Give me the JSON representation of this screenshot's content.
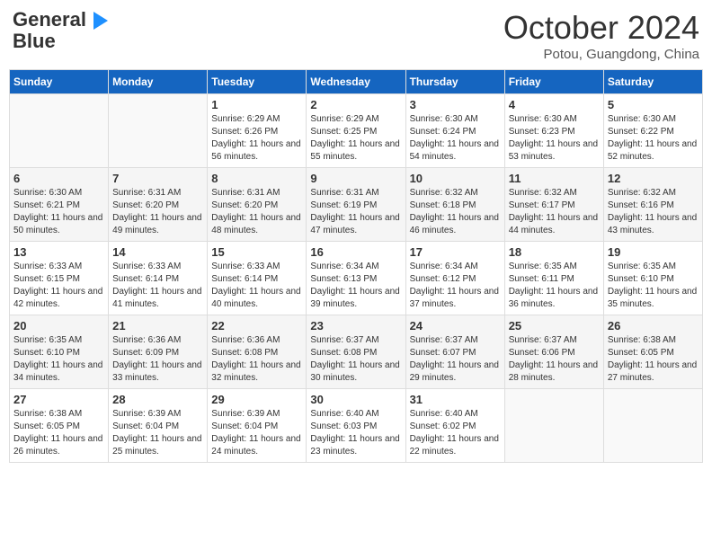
{
  "header": {
    "logo_line1": "General",
    "logo_line2": "Blue",
    "month": "October 2024",
    "location": "Potou, Guangdong, China"
  },
  "weekdays": [
    "Sunday",
    "Monday",
    "Tuesday",
    "Wednesday",
    "Thursday",
    "Friday",
    "Saturday"
  ],
  "weeks": [
    [
      {
        "day": "",
        "sunrise": "",
        "sunset": "",
        "daylight": ""
      },
      {
        "day": "",
        "sunrise": "",
        "sunset": "",
        "daylight": ""
      },
      {
        "day": "1",
        "sunrise": "Sunrise: 6:29 AM",
        "sunset": "Sunset: 6:26 PM",
        "daylight": "Daylight: 11 hours and 56 minutes."
      },
      {
        "day": "2",
        "sunrise": "Sunrise: 6:29 AM",
        "sunset": "Sunset: 6:25 PM",
        "daylight": "Daylight: 11 hours and 55 minutes."
      },
      {
        "day": "3",
        "sunrise": "Sunrise: 6:30 AM",
        "sunset": "Sunset: 6:24 PM",
        "daylight": "Daylight: 11 hours and 54 minutes."
      },
      {
        "day": "4",
        "sunrise": "Sunrise: 6:30 AM",
        "sunset": "Sunset: 6:23 PM",
        "daylight": "Daylight: 11 hours and 53 minutes."
      },
      {
        "day": "5",
        "sunrise": "Sunrise: 6:30 AM",
        "sunset": "Sunset: 6:22 PM",
        "daylight": "Daylight: 11 hours and 52 minutes."
      }
    ],
    [
      {
        "day": "6",
        "sunrise": "Sunrise: 6:30 AM",
        "sunset": "Sunset: 6:21 PM",
        "daylight": "Daylight: 11 hours and 50 minutes."
      },
      {
        "day": "7",
        "sunrise": "Sunrise: 6:31 AM",
        "sunset": "Sunset: 6:20 PM",
        "daylight": "Daylight: 11 hours and 49 minutes."
      },
      {
        "day": "8",
        "sunrise": "Sunrise: 6:31 AM",
        "sunset": "Sunset: 6:20 PM",
        "daylight": "Daylight: 11 hours and 48 minutes."
      },
      {
        "day": "9",
        "sunrise": "Sunrise: 6:31 AM",
        "sunset": "Sunset: 6:19 PM",
        "daylight": "Daylight: 11 hours and 47 minutes."
      },
      {
        "day": "10",
        "sunrise": "Sunrise: 6:32 AM",
        "sunset": "Sunset: 6:18 PM",
        "daylight": "Daylight: 11 hours and 46 minutes."
      },
      {
        "day": "11",
        "sunrise": "Sunrise: 6:32 AM",
        "sunset": "Sunset: 6:17 PM",
        "daylight": "Daylight: 11 hours and 44 minutes."
      },
      {
        "day": "12",
        "sunrise": "Sunrise: 6:32 AM",
        "sunset": "Sunset: 6:16 PM",
        "daylight": "Daylight: 11 hours and 43 minutes."
      }
    ],
    [
      {
        "day": "13",
        "sunrise": "Sunrise: 6:33 AM",
        "sunset": "Sunset: 6:15 PM",
        "daylight": "Daylight: 11 hours and 42 minutes."
      },
      {
        "day": "14",
        "sunrise": "Sunrise: 6:33 AM",
        "sunset": "Sunset: 6:14 PM",
        "daylight": "Daylight: 11 hours and 41 minutes."
      },
      {
        "day": "15",
        "sunrise": "Sunrise: 6:33 AM",
        "sunset": "Sunset: 6:14 PM",
        "daylight": "Daylight: 11 hours and 40 minutes."
      },
      {
        "day": "16",
        "sunrise": "Sunrise: 6:34 AM",
        "sunset": "Sunset: 6:13 PM",
        "daylight": "Daylight: 11 hours and 39 minutes."
      },
      {
        "day": "17",
        "sunrise": "Sunrise: 6:34 AM",
        "sunset": "Sunset: 6:12 PM",
        "daylight": "Daylight: 11 hours and 37 minutes."
      },
      {
        "day": "18",
        "sunrise": "Sunrise: 6:35 AM",
        "sunset": "Sunset: 6:11 PM",
        "daylight": "Daylight: 11 hours and 36 minutes."
      },
      {
        "day": "19",
        "sunrise": "Sunrise: 6:35 AM",
        "sunset": "Sunset: 6:10 PM",
        "daylight": "Daylight: 11 hours and 35 minutes."
      }
    ],
    [
      {
        "day": "20",
        "sunrise": "Sunrise: 6:35 AM",
        "sunset": "Sunset: 6:10 PM",
        "daylight": "Daylight: 11 hours and 34 minutes."
      },
      {
        "day": "21",
        "sunrise": "Sunrise: 6:36 AM",
        "sunset": "Sunset: 6:09 PM",
        "daylight": "Daylight: 11 hours and 33 minutes."
      },
      {
        "day": "22",
        "sunrise": "Sunrise: 6:36 AM",
        "sunset": "Sunset: 6:08 PM",
        "daylight": "Daylight: 11 hours and 32 minutes."
      },
      {
        "day": "23",
        "sunrise": "Sunrise: 6:37 AM",
        "sunset": "Sunset: 6:08 PM",
        "daylight": "Daylight: 11 hours and 30 minutes."
      },
      {
        "day": "24",
        "sunrise": "Sunrise: 6:37 AM",
        "sunset": "Sunset: 6:07 PM",
        "daylight": "Daylight: 11 hours and 29 minutes."
      },
      {
        "day": "25",
        "sunrise": "Sunrise: 6:37 AM",
        "sunset": "Sunset: 6:06 PM",
        "daylight": "Daylight: 11 hours and 28 minutes."
      },
      {
        "day": "26",
        "sunrise": "Sunrise: 6:38 AM",
        "sunset": "Sunset: 6:05 PM",
        "daylight": "Daylight: 11 hours and 27 minutes."
      }
    ],
    [
      {
        "day": "27",
        "sunrise": "Sunrise: 6:38 AM",
        "sunset": "Sunset: 6:05 PM",
        "daylight": "Daylight: 11 hours and 26 minutes."
      },
      {
        "day": "28",
        "sunrise": "Sunrise: 6:39 AM",
        "sunset": "Sunset: 6:04 PM",
        "daylight": "Daylight: 11 hours and 25 minutes."
      },
      {
        "day": "29",
        "sunrise": "Sunrise: 6:39 AM",
        "sunset": "Sunset: 6:04 PM",
        "daylight": "Daylight: 11 hours and 24 minutes."
      },
      {
        "day": "30",
        "sunrise": "Sunrise: 6:40 AM",
        "sunset": "Sunset: 6:03 PM",
        "daylight": "Daylight: 11 hours and 23 minutes."
      },
      {
        "day": "31",
        "sunrise": "Sunrise: 6:40 AM",
        "sunset": "Sunset: 6:02 PM",
        "daylight": "Daylight: 11 hours and 22 minutes."
      },
      {
        "day": "",
        "sunrise": "",
        "sunset": "",
        "daylight": ""
      },
      {
        "day": "",
        "sunrise": "",
        "sunset": "",
        "daylight": ""
      }
    ]
  ]
}
